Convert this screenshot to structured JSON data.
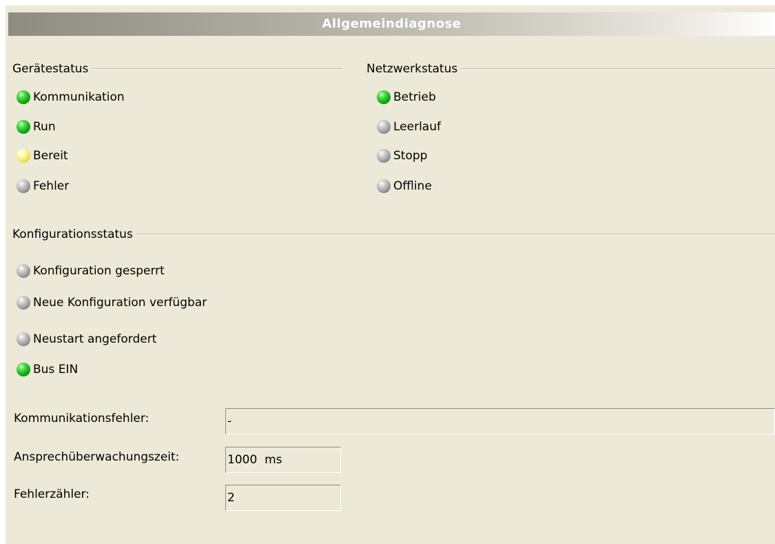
{
  "title": "Allgemeindiagnose",
  "device_status": {
    "heading": "Gerätestatus",
    "items": [
      {
        "label": "Kommunikation",
        "state": "green"
      },
      {
        "label": "Run",
        "state": "green"
      },
      {
        "label": "Bereit",
        "state": "yellow"
      },
      {
        "label": "Fehler",
        "state": "gray"
      }
    ]
  },
  "network_status": {
    "heading": "Netzwerkstatus",
    "items": [
      {
        "label": "Betrieb",
        "state": "green"
      },
      {
        "label": "Leerlauf",
        "state": "gray"
      },
      {
        "label": "Stopp",
        "state": "gray"
      },
      {
        "label": "Offline",
        "state": "gray"
      }
    ]
  },
  "config_status": {
    "heading": "Konfigurationsstatus",
    "items": [
      {
        "label": "Konfiguration gesperrt",
        "state": "gray"
      },
      {
        "label": "Neue Konfiguration verfügbar",
        "state": "gray"
      },
      {
        "label": "Neustart angefordert",
        "state": "gray"
      },
      {
        "label": "Bus EIN",
        "state": "green"
      }
    ]
  },
  "fields": {
    "comm_error": {
      "label": "Kommunikationsfehler:",
      "value": "-"
    },
    "watchdog_time": {
      "label": "Ansprechüberwachungszeit:",
      "value": "1000  ms"
    },
    "error_counter": {
      "label": "Fehlerzähler:",
      "value": "2"
    }
  },
  "colors": {
    "green": "#19b319",
    "gray": "#9e9e9e",
    "yellow": "#f2e45c",
    "panel_bg": "#ece9d8"
  }
}
